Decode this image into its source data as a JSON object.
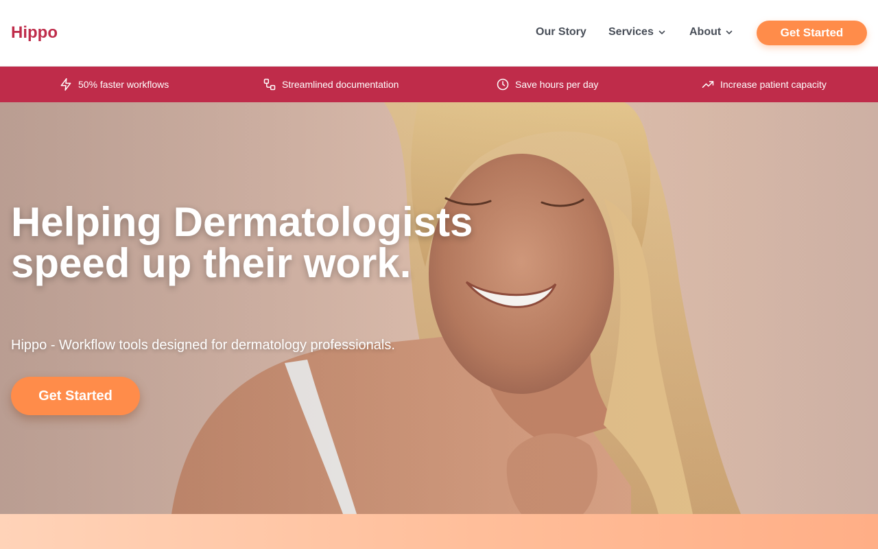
{
  "brand": {
    "name": "Hippo",
    "color": "#bf2c4a"
  },
  "nav": {
    "items": [
      {
        "label": "Our Story",
        "has_dropdown": false
      },
      {
        "label": "Services",
        "has_dropdown": true
      },
      {
        "label": "About",
        "has_dropdown": true
      }
    ],
    "cta_label": "Get Started"
  },
  "features": [
    {
      "icon": "lightning-icon",
      "label": "50% faster workflows"
    },
    {
      "icon": "workflow-icon",
      "label": "Streamlined documentation"
    },
    {
      "icon": "clock-icon",
      "label": "Save hours per day"
    },
    {
      "icon": "trending-up-icon",
      "label": "Increase patient capacity"
    }
  ],
  "hero": {
    "title": "Helping Dermatologists speed up their work.",
    "subtitle": "Hippo - Workflow tools designed for dermatology professionals.",
    "cta_label": "Get Started"
  },
  "colors": {
    "accent": "#ff8c4a",
    "strip": "#bf2c4a",
    "nav_text": "#474d57"
  }
}
